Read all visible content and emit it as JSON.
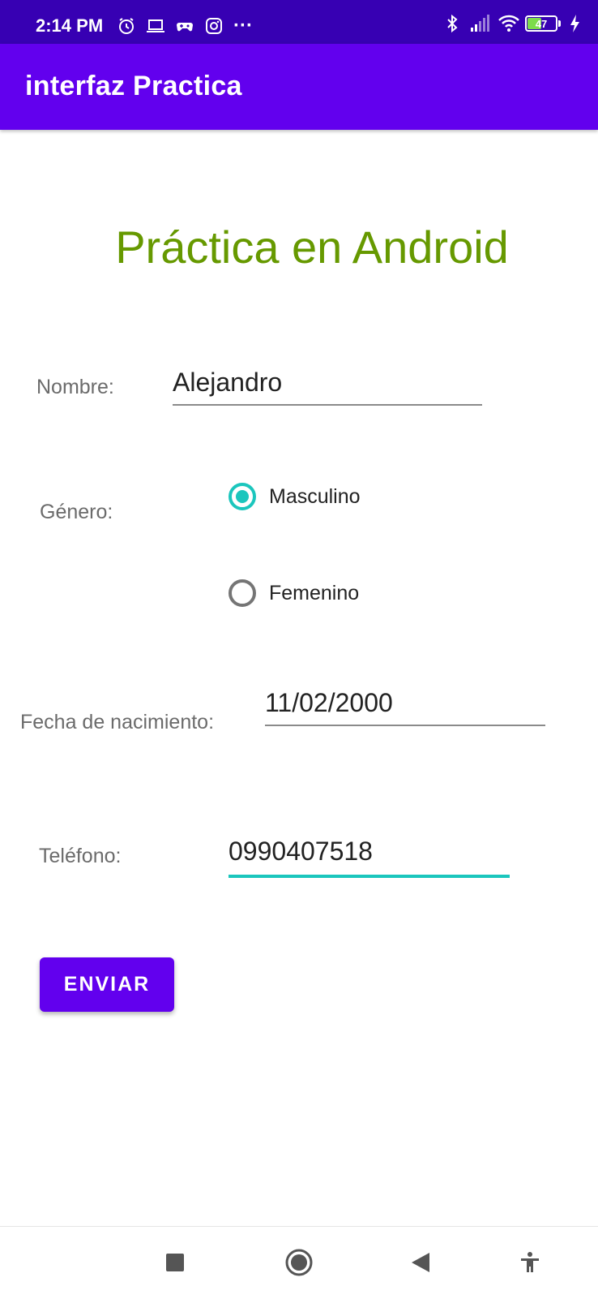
{
  "status_bar": {
    "time": "2:14 PM",
    "left_icons": [
      "alarm-icon",
      "laptop-icon",
      "game-controller-icon",
      "instagram-icon",
      "more-dots-icon"
    ],
    "right_icons": [
      "bluetooth-icon",
      "cellular-signal-icon",
      "wifi-icon",
      "battery-icon",
      "charging-bolt-icon"
    ],
    "battery_level": "47",
    "more": "···"
  },
  "app_bar": {
    "title": "interfaz Practica"
  },
  "main": {
    "heading": "Práctica en Android",
    "name": {
      "label": "Nombre:",
      "value": "Alejandro"
    },
    "gender": {
      "label": "Género:",
      "options": [
        {
          "label": "Masculino",
          "checked": true
        },
        {
          "label": "Femenino",
          "checked": false
        }
      ]
    },
    "birthdate": {
      "label": "Fecha de nacimiento:",
      "value": "11/02/2000"
    },
    "phone": {
      "label": "Teléfono:",
      "value": "0990407518"
    },
    "submit_label": "ENVIAR"
  },
  "nav_bar": {
    "buttons": [
      "recents-square-icon",
      "home-circle-icon",
      "back-triangle-icon",
      "accessibility-icon"
    ]
  },
  "colors": {
    "status_bar": "#3700b3",
    "app_bar": "#6200ee",
    "heading": "#669900",
    "accent": "#1bc6bd",
    "button": "#6200ee"
  }
}
